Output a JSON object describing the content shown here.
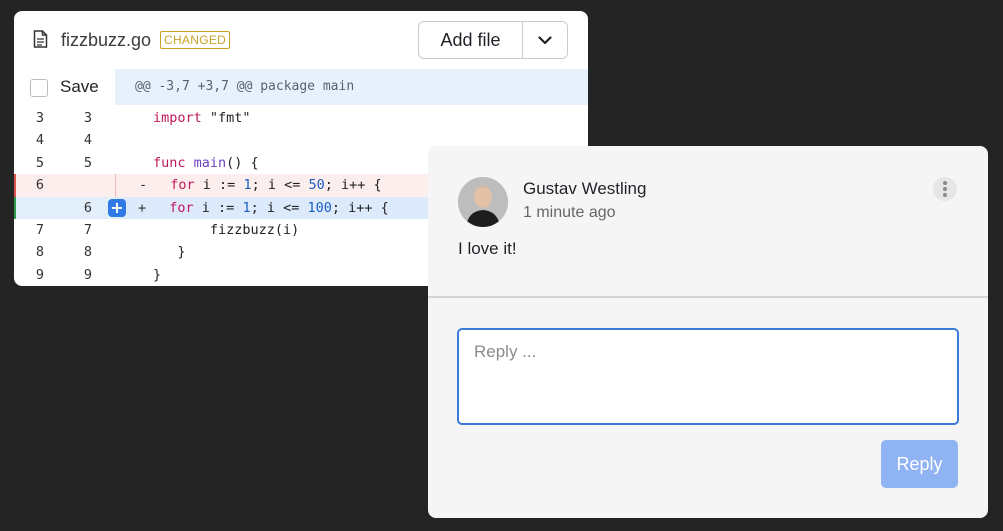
{
  "file": {
    "name": "fizzbuzz.go",
    "status_badge": "CHANGED",
    "add_file_label": "Add file",
    "dropdown_icon": "chevron-down-icon"
  },
  "save": {
    "label": "Save",
    "checked": false
  },
  "hunk": {
    "header": "@@ -3,7 +3,7 @@ package main"
  },
  "lines": [
    {
      "old": "3",
      "new": "3",
      "type": "context",
      "sign": "",
      "code": "import \"fmt\""
    },
    {
      "old": "4",
      "new": "4",
      "type": "context",
      "sign": "",
      "code": ""
    },
    {
      "old": "5",
      "new": "5",
      "type": "context",
      "sign": "",
      "code": "func main() {"
    },
    {
      "old": "6",
      "new": "",
      "type": "deletion",
      "sign": "-",
      "code": "  for i := 1; i <= 50; i++ {"
    },
    {
      "old": "",
      "new": "6",
      "type": "addition",
      "sign": "+",
      "code": "  for i := 1; i <= 100; i++ {"
    },
    {
      "old": "7",
      "new": "7",
      "type": "context",
      "sign": "",
      "code": "       fizzbuzz(i)"
    },
    {
      "old": "8",
      "new": "8",
      "type": "context",
      "sign": "",
      "code": "   }"
    },
    {
      "old": "9",
      "new": "9",
      "type": "context",
      "sign": "",
      "code": "}"
    }
  ],
  "comment": {
    "author": "Gustav Westling",
    "time": "1 minute ago",
    "body": "I love it!",
    "reply_placeholder": "Reply ...",
    "reply_button": "Reply",
    "accent": "#3b7bd8"
  }
}
